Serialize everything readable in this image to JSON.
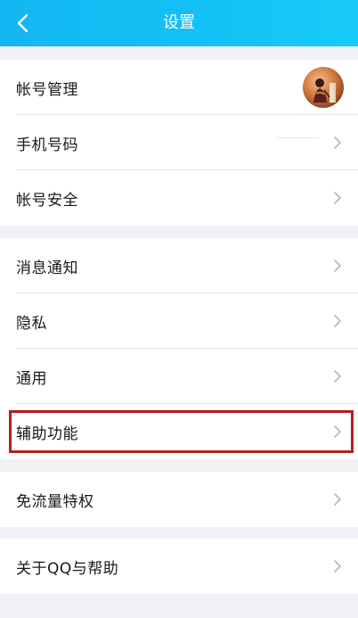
{
  "header": {
    "title": "设置"
  },
  "groups": [
    {
      "items": [
        {
          "label": "帐号管理",
          "right": "avatar"
        },
        {
          "label": "手机号码",
          "right": "chevron"
        },
        {
          "label": "帐号安全",
          "right": "chevron"
        }
      ]
    },
    {
      "items": [
        {
          "label": "消息通知",
          "right": "chevron"
        },
        {
          "label": "隐私",
          "right": "chevron"
        },
        {
          "label": "通用",
          "right": "chevron"
        },
        {
          "label": "辅助功能",
          "right": "chevron",
          "highlighted": true
        }
      ]
    },
    {
      "items": [
        {
          "label": "免流量特权",
          "right": "chevron"
        }
      ]
    },
    {
      "items": [
        {
          "label": "关于QQ与帮助",
          "right": "chevron"
        }
      ]
    }
  ],
  "colors": {
    "header": "#14b6f2",
    "highlight_border": "#b21f23",
    "background": "#f2f2f6",
    "chevron": "#b5b5b9"
  },
  "icons": {
    "back": "back-chevron-icon",
    "row": "chevron-right-icon",
    "avatar": "avatar"
  }
}
